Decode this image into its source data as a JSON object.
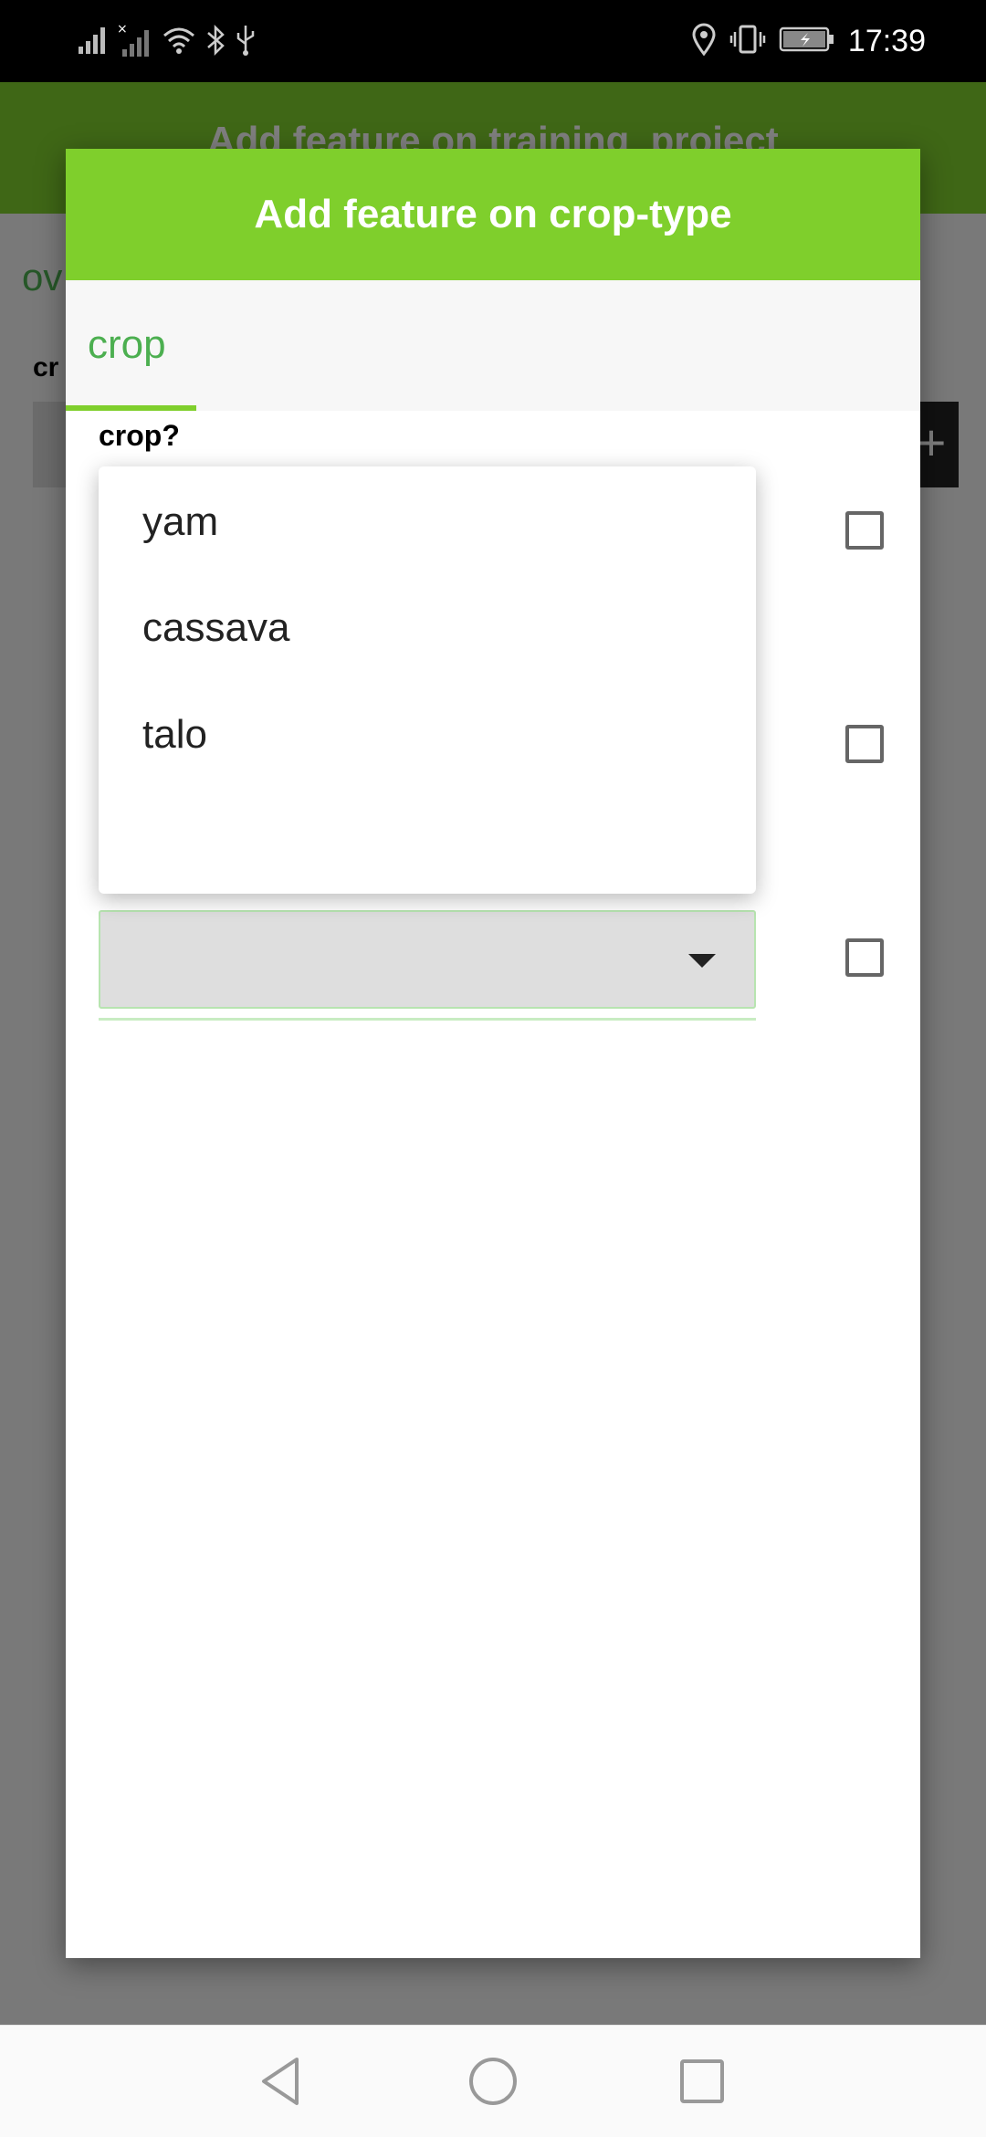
{
  "status_bar": {
    "time": "17:39",
    "icons": [
      "signal-icon",
      "signal-no-sim-icon",
      "wifi-icon",
      "bluetooth-icon",
      "usb-icon",
      "location-icon",
      "vibrate-icon",
      "battery-charging-icon"
    ]
  },
  "background": {
    "header_title": "Add feature on training_project",
    "tab_label": "ov",
    "field_label": "cr",
    "add_button": "+"
  },
  "dialog": {
    "title": "Add feature on crop-type",
    "tabs": [
      {
        "label": "crop",
        "selected": true
      }
    ],
    "question": "crop?",
    "dropdown_options": [
      "yam",
      "cassava",
      "talo"
    ],
    "select_value": ""
  },
  "nav_bar": {
    "buttons": [
      "back-icon",
      "home-icon",
      "recents-icon"
    ]
  },
  "colors": {
    "accent": "#7fcf2c",
    "tab_text": "#4caf50",
    "scrim": "#000000"
  }
}
